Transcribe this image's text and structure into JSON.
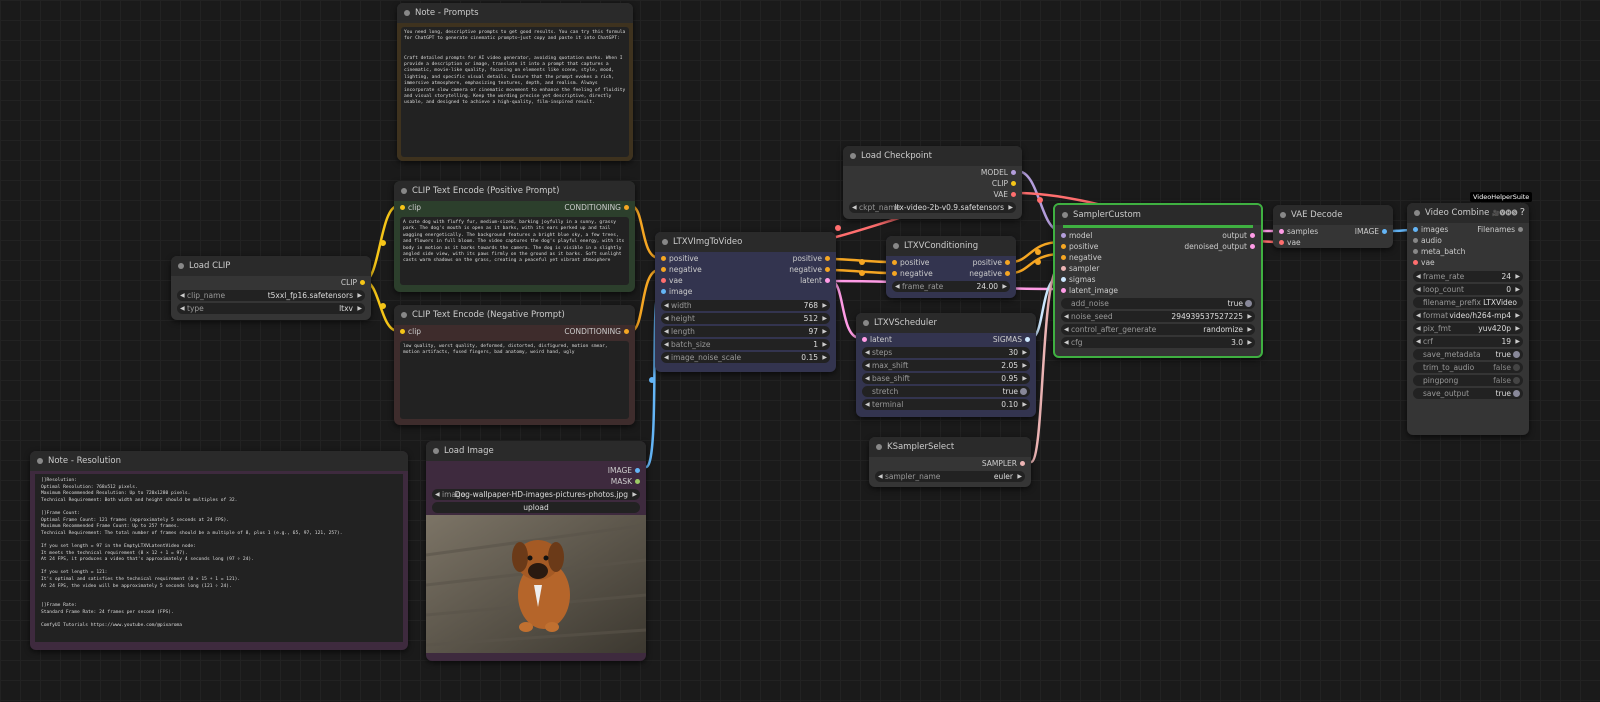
{
  "note_prompts": {
    "title": "Note - Prompts",
    "text": "You need long, descriptive prompts to get good results. You can try this formula for ChatGPT to generate cinematic prompts—just copy and paste it into ChatGPT:\n\n\nCraft detailed prompts for AI video generator, avoiding quotation marks. When I provide a description or image, translate it into a prompt that captures a cinematic, movie-like quality, focusing on elements like scene, style, mood, lighting, and specific visual details. Ensure that the prompt evokes a rich, immersive atmosphere, emphasizing textures, depth, and realism. Always incorporate slow camera or cinematic movement to enhance the feeling of fluidity and visual storytelling. Keep the wording precise yet descriptive, directly usable, and designed to achieve a high-quality, film-inspired result."
  },
  "clip_pos": {
    "title": "CLIP Text Encode (Positive Prompt)",
    "in_clip": "clip",
    "out_cond": "CONDITIONING",
    "text": "A cute dog with fluffy fur, medium-sized, barking joyfully in a sunny, grassy park. The dog's mouth is open as it barks, with its ears perked up and tail wagging energetically. The background features a bright blue sky, a few trees, and flowers in full bloom. The video captures the dog's playful energy, with its body in motion as it barks towards the camera. The dog is visible in a slightly angled side view, with its paws firmly on the ground as it barks. Soft sunlight casts warm shadows on the grass, creating a peaceful yet vibrant atmosphere"
  },
  "clip_neg": {
    "title": "CLIP Text Encode (Negative Prompt)",
    "in_clip": "clip",
    "out_cond": "CONDITIONING",
    "text": "low quality, worst quality, deformed, distorted, disfigured, motion smear, motion artifacts, fused fingers, bad anatomy, weird hand, ugly"
  },
  "load_clip": {
    "title": "Load CLIP",
    "out_clip": "CLIP",
    "w1_label": "clip_name",
    "w1_value": "t5xxl_fp16.safetensors",
    "w2_label": "type",
    "w2_value": "ltxv"
  },
  "ltxv_img": {
    "title": "LTXVImgToVideo",
    "in_positive": "positive",
    "in_negative": "negative",
    "in_vae": "vae",
    "in_image": "image",
    "out_positive": "positive",
    "out_negative": "negative",
    "out_latent": "latent",
    "width_label": "width",
    "width_value": "768",
    "height_label": "height",
    "height_value": "512",
    "length_label": "length",
    "length_value": "97",
    "batch_label": "batch_size",
    "batch_value": "1",
    "noise_label": "image_noise_scale",
    "noise_value": "0.15"
  },
  "ltxv_cond": {
    "title": "LTXVConditioning",
    "in_positive": "positive",
    "in_negative": "negative",
    "out_positive": "positive",
    "out_negative": "negative",
    "fr_label": "frame_rate",
    "fr_value": "24.00"
  },
  "ltxv_sched": {
    "title": "LTXVScheduler",
    "in_latent": "latent",
    "out_sigmas": "SIGMAS",
    "steps_label": "steps",
    "steps_value": "30",
    "max_label": "max_shift",
    "max_value": "2.05",
    "base_label": "base_shift",
    "base_value": "0.95",
    "stretch_label": "stretch",
    "stretch_value": "true",
    "term_label": "terminal",
    "term_value": "0.10"
  },
  "ksampler_select": {
    "title": "KSamplerSelect",
    "out_sampler": "SAMPLER",
    "w_label": "sampler_name",
    "w_value": "euler"
  },
  "load_ckpt": {
    "title": "Load Checkpoint",
    "out_model": "MODEL",
    "out_clip": "CLIP",
    "out_vae": "VAE",
    "w_label": "ckpt_name",
    "w_value": "ltx-video-2b-v0.9.safetensors"
  },
  "sampler_custom": {
    "title": "SamplerCustom",
    "in_model": "model",
    "in_positive": "positive",
    "in_negative": "negative",
    "in_sampler": "sampler",
    "in_sigmas": "sigmas",
    "in_latent": "latent_image",
    "out_output": "output",
    "out_denoised": "denoised_output",
    "add_noise_label": "add_noise",
    "add_noise_value": "true",
    "seed_label": "noise_seed",
    "seed_value": "294939537527225",
    "ctrl_label": "control_after_generate",
    "ctrl_value": "randomize",
    "cfg_label": "cfg",
    "cfg_value": "3.0"
  },
  "vae_decode": {
    "title": "VAE Decode",
    "in_samples": "samples",
    "in_vae": "vae",
    "out_image": "IMAGE"
  },
  "video_combine": {
    "title": "Video Combine",
    "badge": "VideoHelperSuite",
    "title_icons": "🎥🅥🅗🅢",
    "help": "?",
    "in_images": "images",
    "in_audio": "audio",
    "in_meta": "meta_batch",
    "in_vae": "vae",
    "out_filenames": "Filenames",
    "fr_label": "frame_rate",
    "fr_value": "24",
    "loop_label": "loop_count",
    "loop_value": "0",
    "prefix_label": "filename_prefix",
    "prefix_value": "LTXVideo",
    "format_label": "format",
    "format_value": "video/h264-mp4",
    "pix_label": "pix_fmt",
    "pix_value": "yuv420p",
    "crf_label": "crf",
    "crf_value": "19",
    "meta_label": "save_metadata",
    "meta_value": "true",
    "trim_label": "trim_to_audio",
    "trim_value": "false",
    "ping_label": "pingpong",
    "ping_value": "false",
    "save_label": "save_output",
    "save_value": "true"
  },
  "note_resolution": {
    "title": "Note - Resolution",
    "text": "[]Resolution:\nOptimal Resolution: 768x512 pixels.\nMaximum Recommended Resolution: Up to 720x1280 pixels.\nTechnical Requirement: Both width and height should be multiples of 32.\n\n[]Frame Count:\nOptimal Frame Count: 121 frames (approximately 5 seconds at 24 FPS).\nMaximum Recommended Frame Count: Up to 257 frames.\nTechnical Requirement: The total number of frames should be a multiple of 8, plus 1 (e.g., 65, 97, 121, 257).\n\nIf you set length = 97 in the EmptyLTXVLatentVideo node:\nIt meets the technical requirement (8 × 12 + 1 = 97).\nAt 24 FPS, it produces a video that's approximately 4 seconds long (97 ÷ 24).\n\nIf you set length = 121:\nIt's optimal and satisfies the technical requirement (8 × 15 + 1 = 121).\nAt 24 FPS, the video will be approximately 5 seconds long (121 ÷ 24).\n\n\n[]Frame Rate:\nStandard Frame Rate: 24 frames per second (FPS).\n\nComfyUI Tutorials https://www.youtube.com/@pixaroma"
  },
  "load_image": {
    "title": "Load Image",
    "out_image": "IMAGE",
    "out_mask": "MASK",
    "w_label": "image",
    "w_value": "Dog-wallpaper-HD-images-pictures-photos.jpg",
    "upload": "upload"
  },
  "colors": {
    "clip": "#f5c518",
    "conditioning": "#f5a623",
    "model": "#b39ddb",
    "vae": "#ff6e6e",
    "latent": "#ff9ce6",
    "image": "#64b5f6",
    "sampler": "#ecb4b4",
    "sigmas": "#cde8ff"
  }
}
